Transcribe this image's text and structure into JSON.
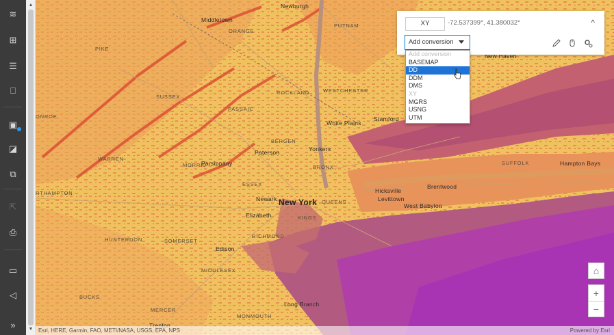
{
  "sidebar": {
    "items": [
      {
        "name": "layers-icon",
        "glyph": "≋"
      },
      {
        "name": "basemap-gallery-icon",
        "glyph": "⊞"
      },
      {
        "name": "legend-icon",
        "glyph": "☰"
      },
      {
        "name": "bookmark-icon",
        "glyph": "⎕"
      },
      {
        "name": "save-icon",
        "glyph": "▣"
      },
      {
        "name": "chart-icon",
        "glyph": "◪"
      },
      {
        "name": "copy-icon",
        "glyph": "⧉"
      },
      {
        "name": "share-icon",
        "glyph": "⇱"
      },
      {
        "name": "print-icon",
        "glyph": "⎙"
      },
      {
        "name": "comment-icon",
        "glyph": "▭"
      },
      {
        "name": "announcement-icon",
        "glyph": "◁"
      },
      {
        "name": "expand-icon",
        "glyph": "»"
      }
    ],
    "accent": "#2e9cf0"
  },
  "coordinate_panel": {
    "xy_label": "XY",
    "coordinates": "-72.537399°, 41.380032°",
    "conversion_select": "Add conversion",
    "conversion_options": [
      "Add conversion",
      "BASEMAP",
      "DD",
      "DDM",
      "DMS",
      "XY",
      "MGRS",
      "USNG",
      "UTM"
    ],
    "selected_option": "DD",
    "collapse_glyph": "^"
  },
  "map_labels": {
    "newburgh": "Newburgh",
    "middletown": "Middletown",
    "orange": "ORANGE",
    "putnam": "PUTNAM",
    "new_haven": "New Haven",
    "pike": "PIKE",
    "sussex": "SUSSEX",
    "rockland": "ROCKLAND",
    "westchester": "WESTCHESTER",
    "passaic": "PASSAIC",
    "monroe": "ONROE",
    "white_plains": "White Plains",
    "stamford": "Stamford",
    "bergen": "BERGEN",
    "paterson": "Paterson",
    "yonkers": "Yonkers",
    "warren": "WARREN",
    "morris": "MORRIS",
    "parsippany": "Parsippany",
    "bronx": "BRONX",
    "suffolk": "SUFFOLK",
    "hampton_bays": "Hampton Bays",
    "northampton": "RTHAMPTON",
    "essex": "ESSEX",
    "newark": "Newark",
    "new_york": "New York",
    "queens": "QUEENS",
    "hicksville": "Hicksville",
    "brentwood": "Brentwood",
    "levittown": "Levittown",
    "west_babylon": "West Babylon",
    "elizabeth": "Elizabeth",
    "kings": "KINGS",
    "richmond": "RICHMOND",
    "hunterdon": "HUNTERDON",
    "somerset": "SOMERSET",
    "edison": "Edison",
    "middlesex": "MIDDLESEX",
    "bucks": "BUCKS",
    "mercer": "MERCER",
    "monmouth": "MONMOUTH",
    "long_branch": "Long Branch",
    "trenton": "Trenton"
  },
  "map_controls": {
    "home_glyph": "⌂",
    "zoom_in": "+",
    "zoom_out": "−"
  },
  "attribution": {
    "sources": "Esri, HERE, Garmin, FAO, METI/NASA, USGS, EPA, NPS",
    "powered_by": "Powered by Esri"
  },
  "colors": {
    "land_base": "#f0c25f",
    "land_orange": "#e89050",
    "ocean_shallow": "#b05a6e",
    "ocean_deep": "#b43cb0",
    "sound": "#c85a78",
    "ridge_red": "#d9442e",
    "selection": "#1e73d6"
  }
}
